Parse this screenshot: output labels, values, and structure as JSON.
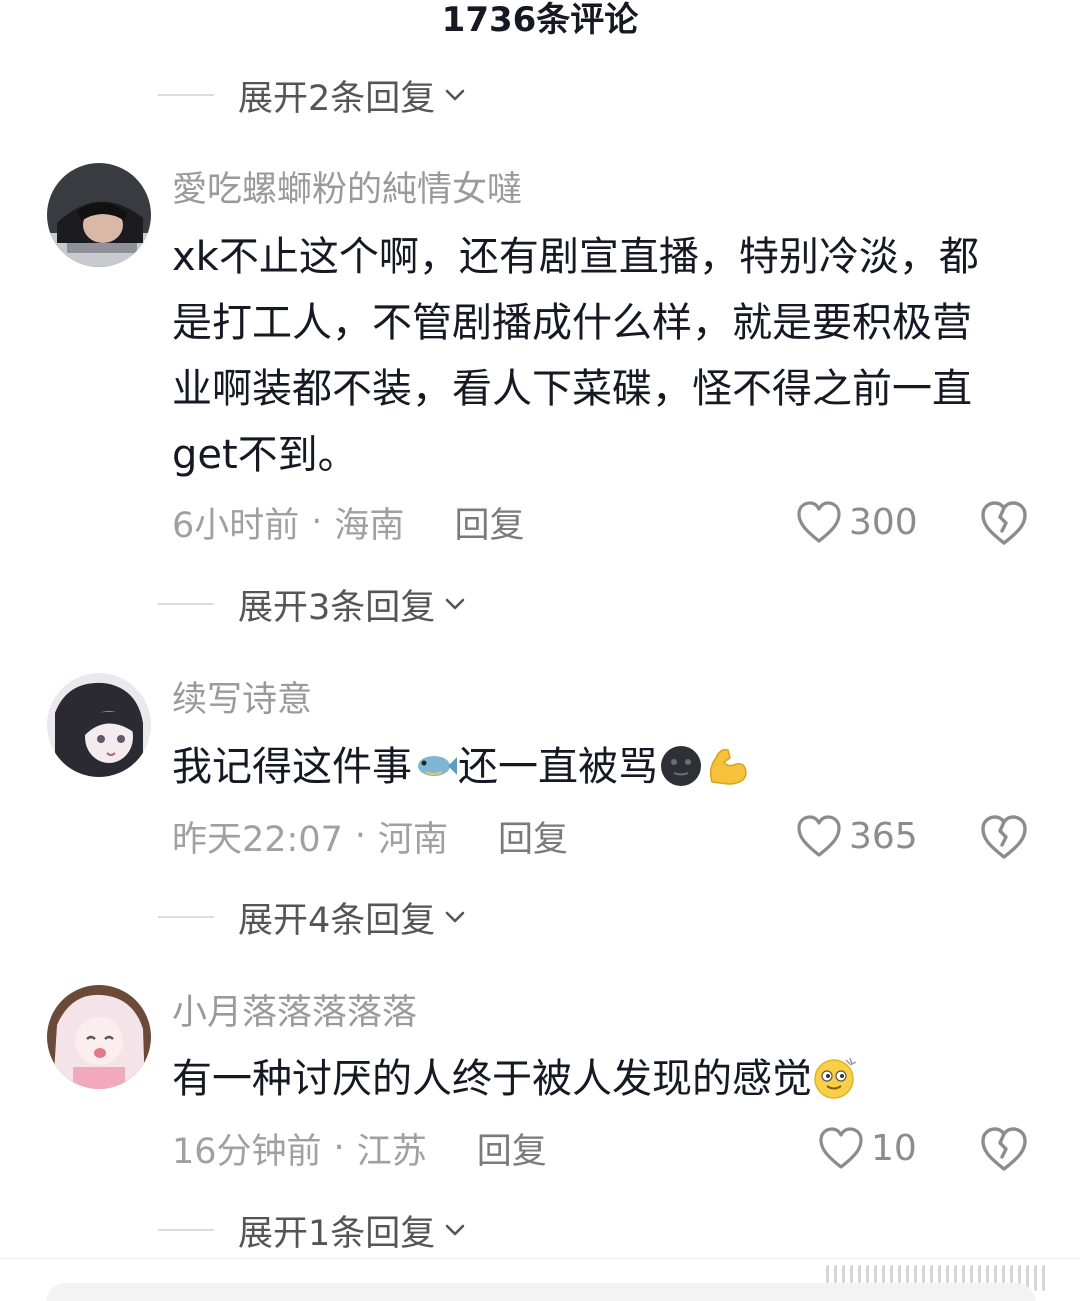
{
  "header": {
    "title": "1736条评论"
  },
  "expand_replies": [
    {
      "label": "展开2条回复"
    },
    {
      "label": "展开3条回复"
    },
    {
      "label": "展开4条回复"
    },
    {
      "label": "展开1条回复"
    }
  ],
  "comments": [
    {
      "username": "愛吃螺螄粉的純情女噠",
      "lines": [
        "xk不止这个啊，还有剧宣直播，特别冷淡，都",
        "是打工人，不管剧播成什么样，就是要积极营",
        "业啊装都不装，看人下菜碟，怪不得之前一直",
        "get不到。"
      ],
      "time": "6小时前",
      "location": "海南",
      "reply_label": "回复",
      "likes": "300",
      "avatar_icon": "avatar-dark-hair-girl"
    },
    {
      "username": "续写诗意",
      "text": "我记得这件事",
      "text2": "还一直被骂",
      "emojis": [
        "fish-emoji",
        "dark-moon-face-emoji",
        "flexed-biceps-emoji"
      ],
      "time": "昨天22:07",
      "location": "河南",
      "reply_label": "回复",
      "likes": "365",
      "avatar_icon": "avatar-anime-dark-hair"
    },
    {
      "username": "小月落落落落落",
      "text": "有一种讨厌的人终于被人发现的感觉",
      "emojis": [
        "dizzy-face-emoji"
      ],
      "time": "16分钟前",
      "location": "江苏",
      "reply_label": "回复",
      "likes": "10",
      "avatar_icon": "avatar-anime-pink-hair"
    }
  ],
  "meta_separator": "·",
  "icons": {
    "like": "heart-outline-icon",
    "dislike": "broken-heart-icon",
    "expand": "chevron-down-icon"
  },
  "colors": {
    "text_primary": "#161823",
    "text_secondary": "#9a9a9a",
    "icon_gray": "#8c8c8c"
  }
}
